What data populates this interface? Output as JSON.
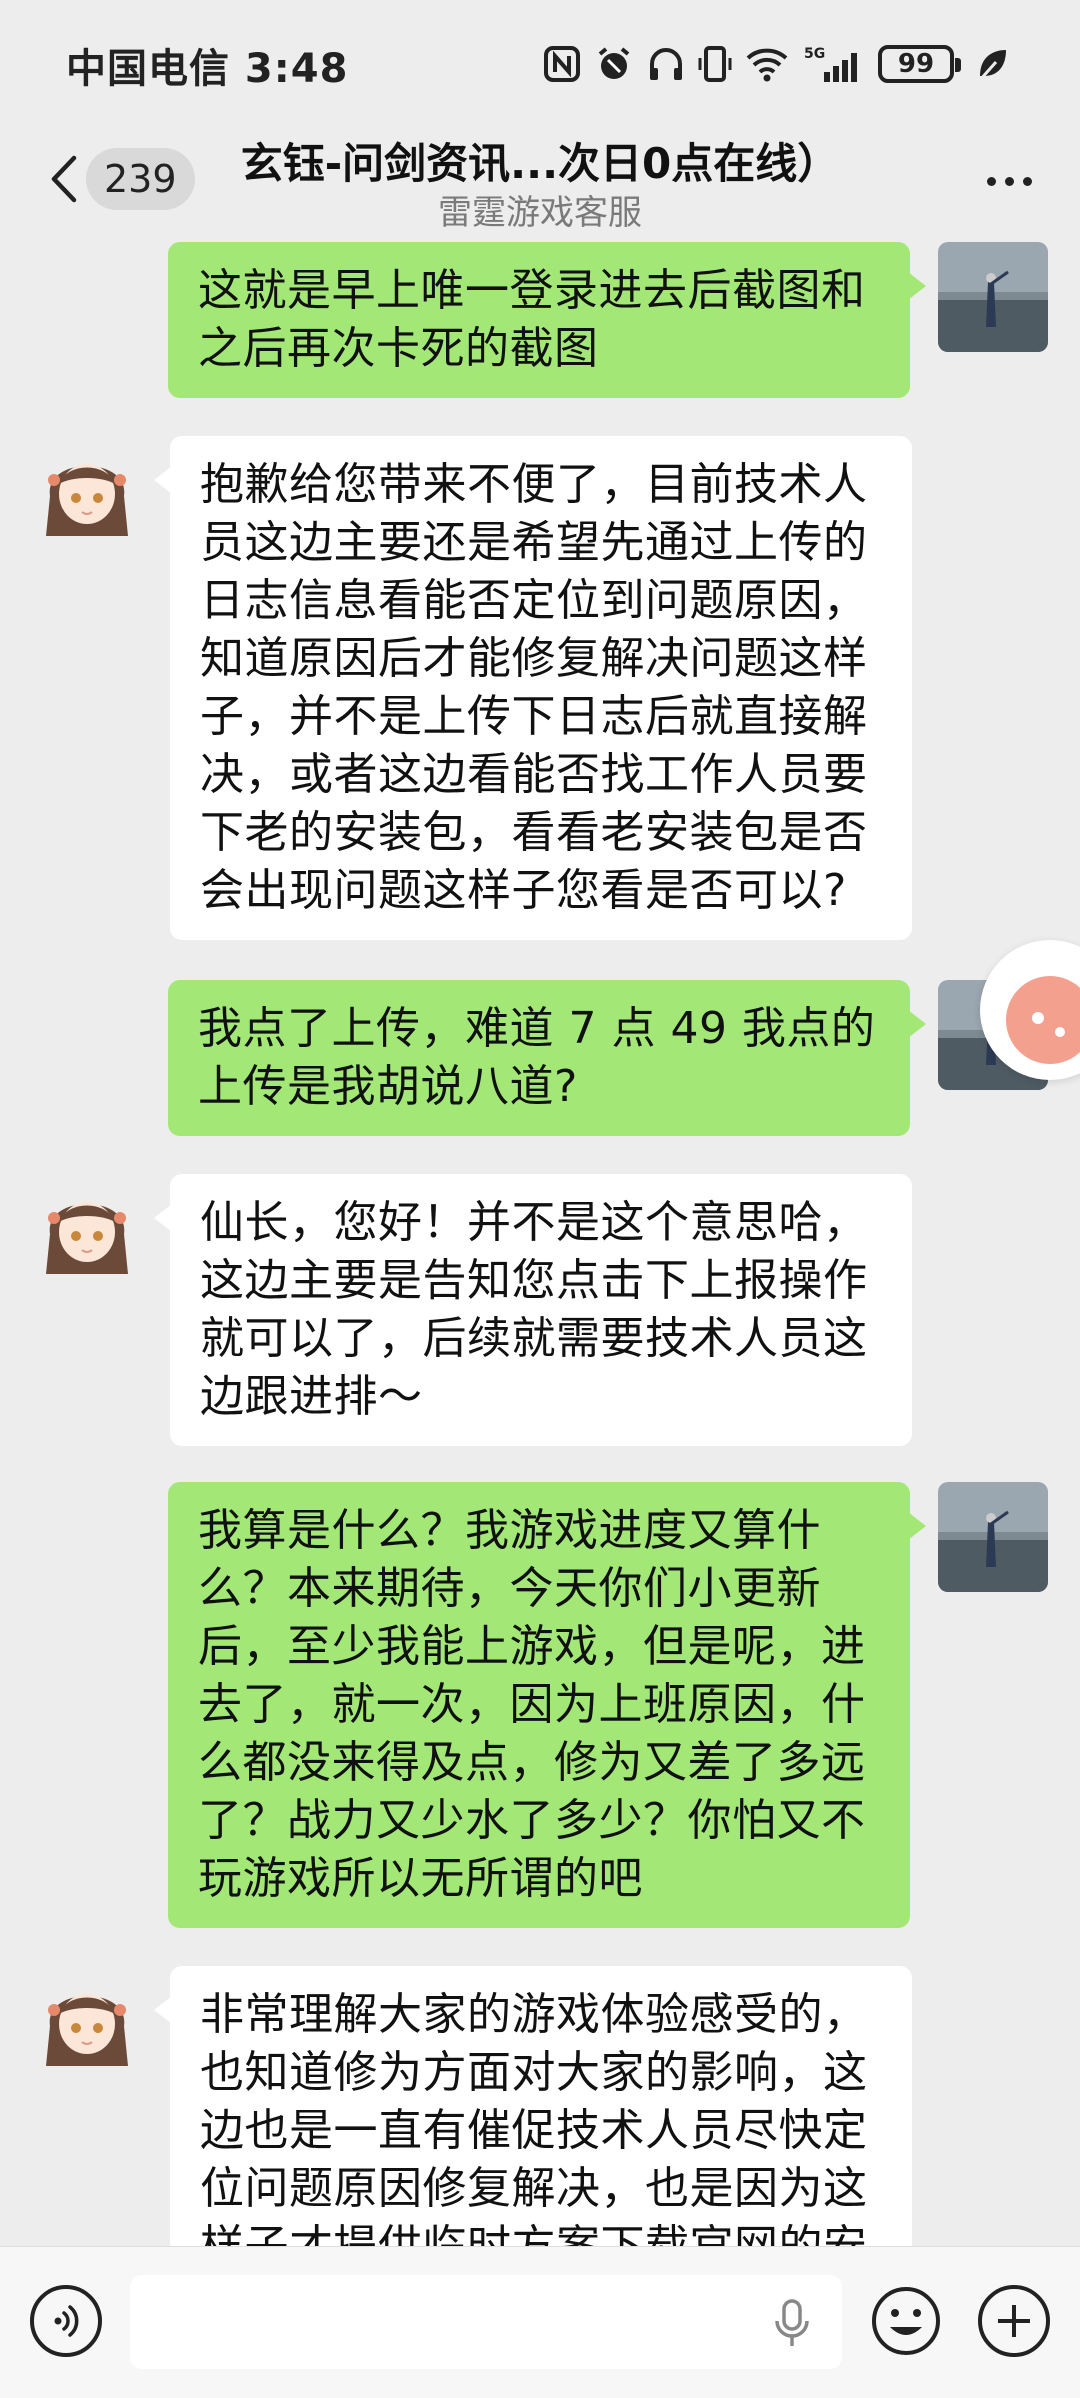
{
  "status_bar": {
    "carrier_time": "中国电信 3:48",
    "battery": "99",
    "network": "5G"
  },
  "header": {
    "unread_count": "239",
    "title": "玄钰-问剑资讯...次日0点在线）",
    "subtitle": "雷霆游戏客服"
  },
  "messages": [
    {
      "from": "me",
      "text": "这就是早上唯一登录进去后截图和之后再次卡死的截图"
    },
    {
      "from": "agent",
      "text": "抱歉给您带来不便了，目前技术人员这边主要还是希望先通过上传的日志信息看能否定位到问题原因，知道原因后才能修复解决问题这样子，并不是上传下日志后就直接解决，或者这边看能否找工作人员要下老的安装包，看看老安装包是否会出现问题这样子您看是否可以?"
    },
    {
      "from": "me",
      "text": "我点了上传，难道 7 点 49 我点的上传是我胡说八道?"
    },
    {
      "from": "agent",
      "text": "仙长，您好！并不是这个意思哈，这边主要是告知您点击下上报操作就可以了，后续就需要技术人员这边跟进排～"
    },
    {
      "from": "me",
      "text": "我算是什么？我游戏进度又算什么？本来期待，今天你们小更新后，至少我能上游戏，但是呢，进去了，就一次，因为上班原因，什么都没来得及点，修为又差了多远了？战力又少水了多少？你怕又不玩游戏所以无所谓的吧"
    },
    {
      "from": "agent",
      "text": "非常理解大家的游戏体验感受的，也知道修为方面对大家的影响，这边也是一直有催促技术人员尽快定位问题原因修复解决，也是因为这样子才提供临时方案下载官网的安"
    }
  ],
  "input_bar": {
    "placeholder": ""
  },
  "colors": {
    "background": "#ededed",
    "outgoing_bubble": "#a3e877",
    "incoming_bubble": "#ffffff"
  },
  "icons": [
    "back-chevron-icon",
    "more-icon",
    "voice-icon",
    "mic-icon",
    "emoji-icon",
    "plus-icon",
    "nfc-icon",
    "alarm-icon",
    "headphone-icon",
    "vibrate-icon",
    "wifi-icon",
    "signal-icon",
    "leaf-icon"
  ]
}
